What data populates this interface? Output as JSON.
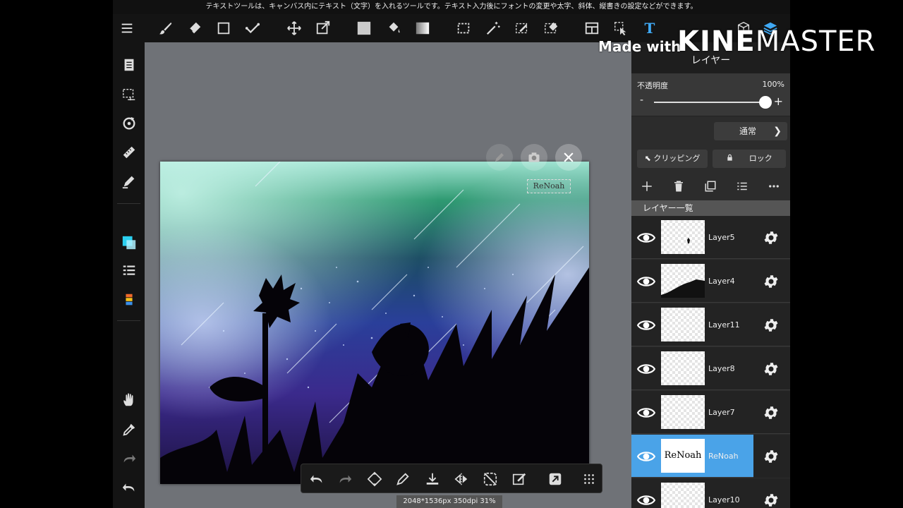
{
  "hint": "テキストツールは、キャンバス内にテキスト（文字）を入れるツールです。テキスト入力後にフォントの変更や太字、斜体、縦書きの設定などができます。",
  "watermark": {
    "made_with": "Made with",
    "brand_bold": "KINE",
    "brand_light": "MASTER"
  },
  "topbar": {
    "icons": [
      "menu-icon",
      "brush-icon",
      "eraser-icon",
      "rectangle-icon",
      "check-select-icon",
      "move-icon",
      "transform-icon",
      "fill-color-swatch",
      "bucket-icon",
      "gradient-icon",
      "select-rect-icon",
      "magic-wand-icon",
      "select-pen-icon",
      "select-eraser-icon",
      "frame-icon",
      "select-move-icon",
      "text-tool-icon",
      "3d-icon",
      "layers-stack-icon"
    ]
  },
  "layer_panel": {
    "title": "レイヤー",
    "opacity_label": "不透明度",
    "opacity_value": "100%",
    "opacity_fraction": 1.0,
    "minus": "-",
    "plus": "+",
    "blend_mode": "通常",
    "clipping_label": "クリッピング",
    "lock_label": "ロック",
    "list_header": "レイヤー一覧",
    "layers": [
      {
        "name": "Layer5",
        "selected": false,
        "thumb": "figure"
      },
      {
        "name": "Layer4",
        "selected": false,
        "thumb": "hill"
      },
      {
        "name": "Layer11",
        "selected": false,
        "thumb": "empty"
      },
      {
        "name": "Layer8",
        "selected": false,
        "thumb": "empty"
      },
      {
        "name": "Layer7",
        "selected": false,
        "thumb": "empty"
      },
      {
        "name": "ReNoah",
        "selected": true,
        "thumb": "text",
        "thumb_text": "ReNoah"
      },
      {
        "name": "Layer10",
        "selected": false,
        "thumb": "empty"
      }
    ]
  },
  "canvas": {
    "text_object": "ReNoah"
  },
  "status": "2048*1536px 350dpi 31%",
  "colors": {
    "accent": "#4aa3e8",
    "workspace": "#6f7277",
    "toolbar": "#141414"
  }
}
